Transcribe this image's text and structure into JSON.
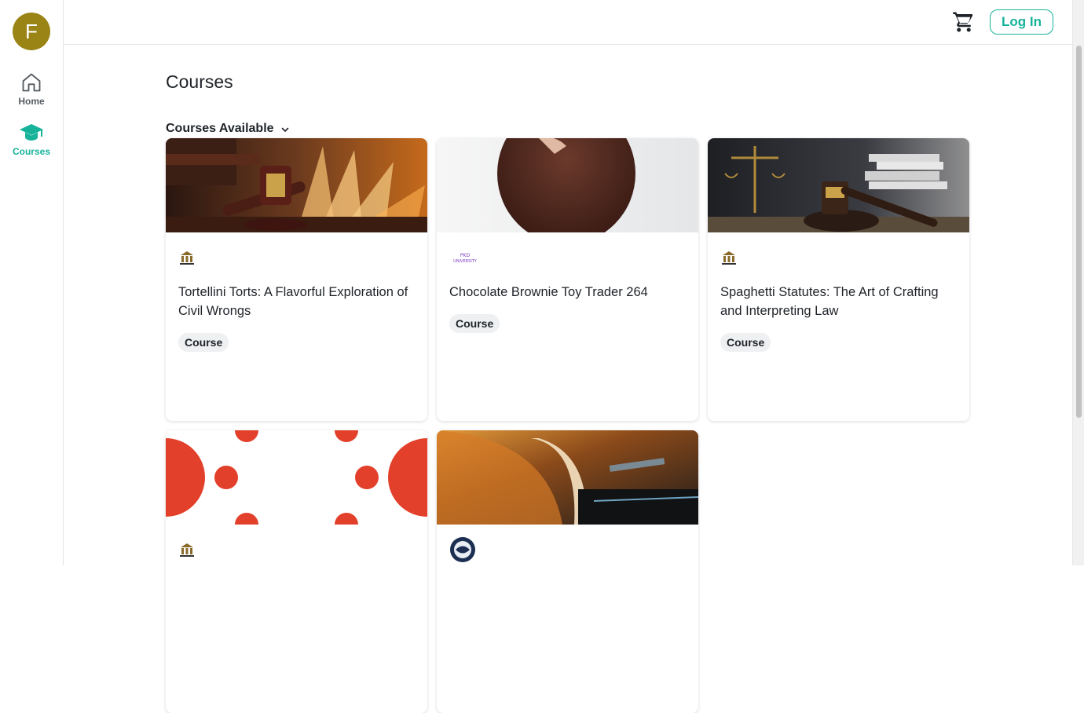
{
  "user": {
    "avatar_initial": "F"
  },
  "sidebar": {
    "items": [
      {
        "label": "Home",
        "icon": "home-icon"
      },
      {
        "label": "Courses",
        "icon": "graduation-cap-icon",
        "active": true
      }
    ]
  },
  "header": {
    "login_label": "Log In",
    "cart_icon": "cart-icon"
  },
  "main": {
    "title": "Courses",
    "filter_label": "Courses Available",
    "courses": [
      {
        "title": "Tortellini Torts: A Flavorful Exploration of Civil Wrongs",
        "badge": "Course",
        "logo": "law-firm-logo",
        "image": "gavel-and-book"
      },
      {
        "title": "Chocolate Brownie Toy Trader 264",
        "badge": "Course",
        "logo_text": "PKD UNIVERSITY",
        "image": "chocolate-cookie"
      },
      {
        "title": "Spaghetti Statutes: The Art of Crafting and Interpreting Law",
        "badge": "Course",
        "logo": "law-firm-logo",
        "image": "gavel-and-scales"
      },
      {
        "title": "",
        "badge": "",
        "logo": "law-firm-logo",
        "image": "red-dots-pattern"
      },
      {
        "title": "",
        "badge": "",
        "logo": "globe-emblem-logo",
        "image": "car-detail"
      }
    ]
  },
  "colors": {
    "accent": "#16b39a",
    "avatar": "#9a8415"
  }
}
